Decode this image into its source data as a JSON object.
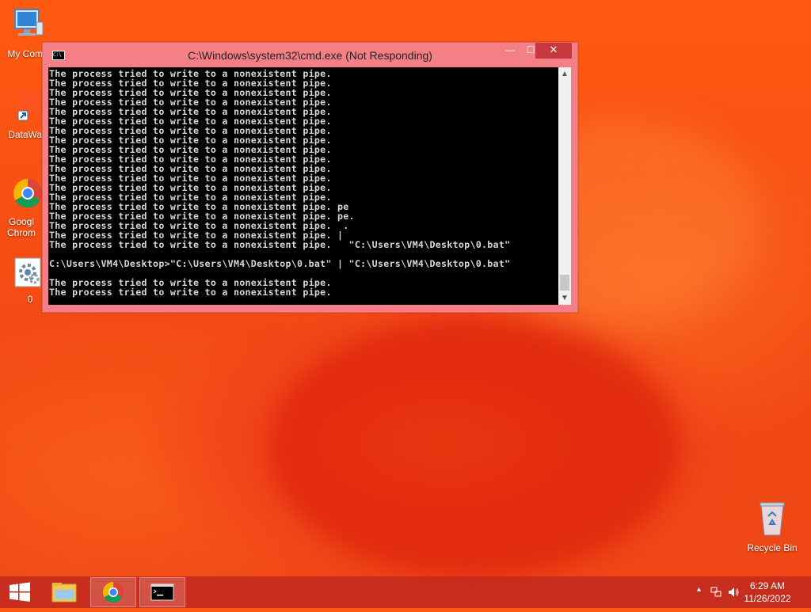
{
  "desktop": {
    "icons": [
      {
        "label": "My Comp",
        "icon": "computer-icon"
      },
      {
        "label": "DataWag",
        "icon": "shortcut-icon"
      },
      {
        "label": "Googl Chrom",
        "icon": "chrome-icon"
      },
      {
        "label": "0",
        "icon": "batch-file-icon"
      },
      {
        "label": "Recycle Bin",
        "icon": "recycle-bin-icon"
      }
    ]
  },
  "window": {
    "title": "C:\\Windows\\system32\\cmd.exe (Not Responding)",
    "buttons": {
      "minimize": "—",
      "maximize": "☐",
      "close": "✕"
    },
    "console_text": "The process tried to write to a nonexistent pipe.\nThe process tried to write to a nonexistent pipe.\nThe process tried to write to a nonexistent pipe.\nThe process tried to write to a nonexistent pipe.\nThe process tried to write to a nonexistent pipe.\nThe process tried to write to a nonexistent pipe.\nThe process tried to write to a nonexistent pipe.\nThe process tried to write to a nonexistent pipe.\nThe process tried to write to a nonexistent pipe.\nThe process tried to write to a nonexistent pipe.\nThe process tried to write to a nonexistent pipe.\nThe process tried to write to a nonexistent pipe.\nThe process tried to write to a nonexistent pipe.\nThe process tried to write to a nonexistent pipe.\nThe process tried to write to a nonexistent pipe. pe\nThe process tried to write to a nonexistent pipe. pe.\nThe process tried to write to a nonexistent pipe.  .\nThe process tried to write to a nonexistent pipe. |\nThe process tried to write to a nonexistent pipe.   \"C:\\Users\\VM4\\Desktop\\0.bat\"\n\nC:\\Users\\VM4\\Desktop>\"C:\\Users\\VM4\\Desktop\\0.bat\" | \"C:\\Users\\VM4\\Desktop\\0.bat\"\n\nThe process tried to write to a nonexistent pipe.\nThe process tried to write to a nonexistent pipe."
  },
  "taskbar": {
    "apps": [
      "file-explorer-icon",
      "chrome-icon",
      "cmd-icon"
    ],
    "tray": {
      "time": "6:29 AM",
      "date": "11/26/2022"
    }
  },
  "colors": {
    "window_frame": "#f47f86",
    "close_button": "#c7383f",
    "console_bg": "#000000"
  }
}
